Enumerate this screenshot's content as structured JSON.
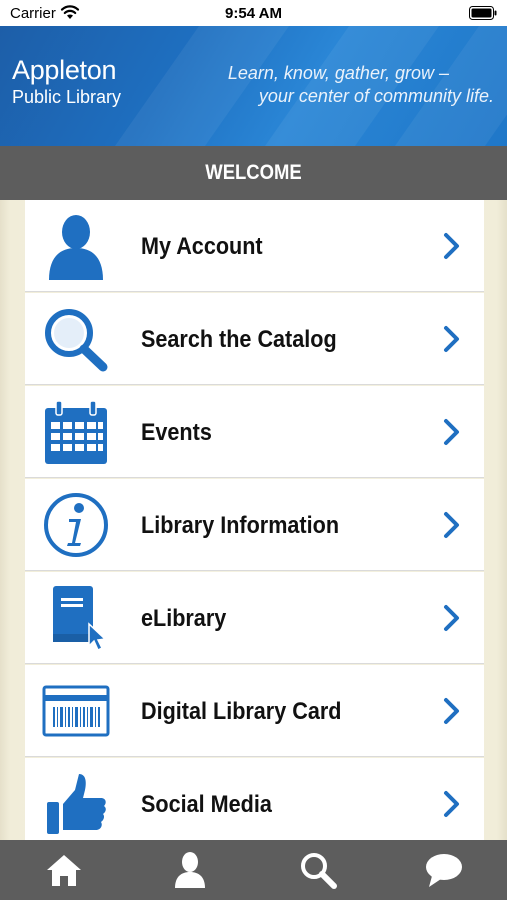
{
  "status_bar": {
    "carrier": "Carrier",
    "time": "9:54 AM"
  },
  "header": {
    "brand_name": "Appleton",
    "brand_sub": "Public Library",
    "tagline_line1": "Learn, know, gather, grow –",
    "tagline_line2": "your center of community life."
  },
  "welcome": {
    "title": "WELCOME"
  },
  "menu": {
    "items": [
      {
        "label": "My Account",
        "icon": "person-icon"
      },
      {
        "label": "Search the Catalog",
        "icon": "magnifier-icon"
      },
      {
        "label": "Events",
        "icon": "calendar-icon"
      },
      {
        "label": "Library Information",
        "icon": "info-icon"
      },
      {
        "label": "eLibrary",
        "icon": "ebook-icon"
      },
      {
        "label": "Digital Library Card",
        "icon": "barcode-card-icon"
      },
      {
        "label": "Social Media",
        "icon": "thumbs-up-icon"
      }
    ]
  },
  "tab_bar": {
    "tabs": [
      {
        "icon": "home-icon"
      },
      {
        "icon": "person-icon"
      },
      {
        "icon": "search-icon"
      },
      {
        "icon": "chat-bubble-icon"
      }
    ]
  },
  "colors": {
    "brand_blue": "#1e6fc0",
    "icon_blue": "#1f6fc1",
    "welcome_bar": "#5d5d5d",
    "tab_bar": "#5d5d5d",
    "menu_bg": "#f1edd9"
  }
}
